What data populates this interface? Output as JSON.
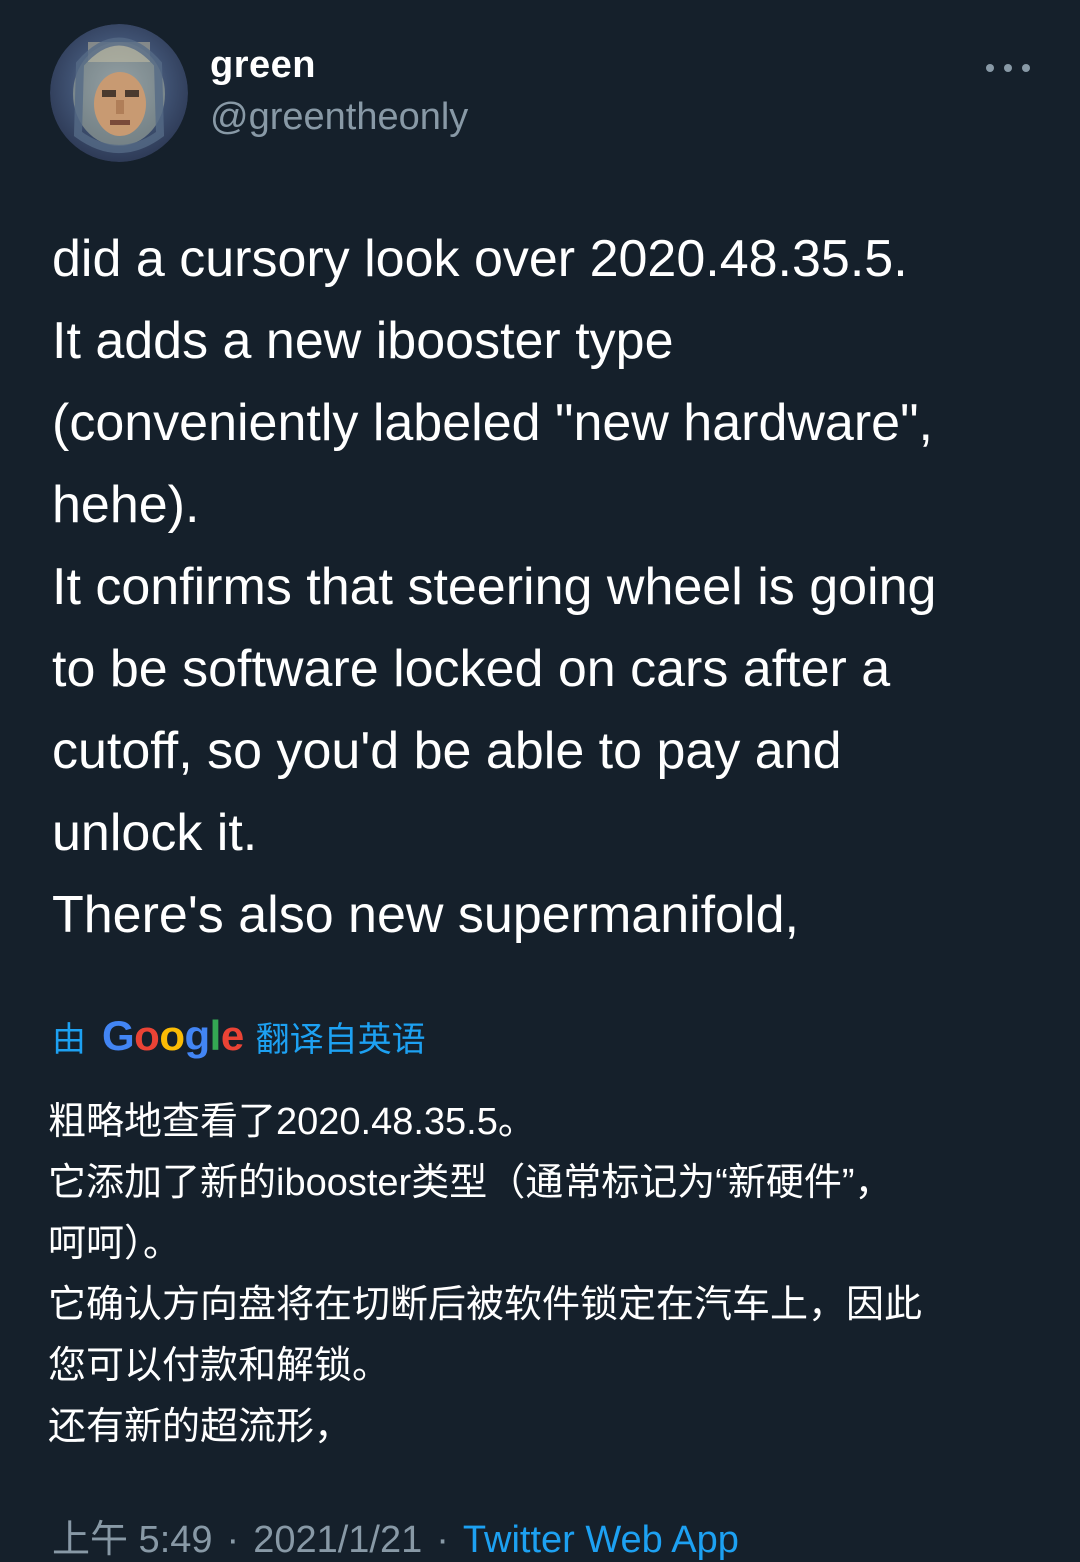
{
  "author": {
    "name": "green",
    "handle": "@greentheonly"
  },
  "tweet": {
    "lines": [
      "did a cursory look over 2020.48.35.5.",
      "It adds a new ibooster type",
      "(conveniently labeled \"new hardware\",",
      "hehe).",
      "It confirms that steering wheel is going",
      "to be software locked on cars after a",
      "cutoff, so you'd be able to pay and",
      "unlock it.",
      "There's also new supermanifold,"
    ]
  },
  "translation": {
    "prefix": "由",
    "provider_letters": [
      "G",
      "o",
      "o",
      "g",
      "l",
      "e"
    ],
    "suffix": "翻译自英语",
    "lines": [
      "粗略地查看了2020.48.35.5。",
      "它添加了新的ibooster类型（通常标记为“新硬件”，",
      "呵呵）。",
      "它确认方向盘将在切断后被软件锁定在汽车上，因此",
      "您可以付款和解锁。",
      "还有新的超流形，"
    ]
  },
  "meta": {
    "time": "上午 5:49",
    "separator": "·",
    "date": "2021/1/21",
    "source": "Twitter Web App"
  },
  "colors": {
    "background": "#15202b",
    "accent": "#1da1f2",
    "secondary_text": "#8899a6"
  },
  "icons": {
    "more": "more-options-icon",
    "avatar": "profile-avatar"
  }
}
